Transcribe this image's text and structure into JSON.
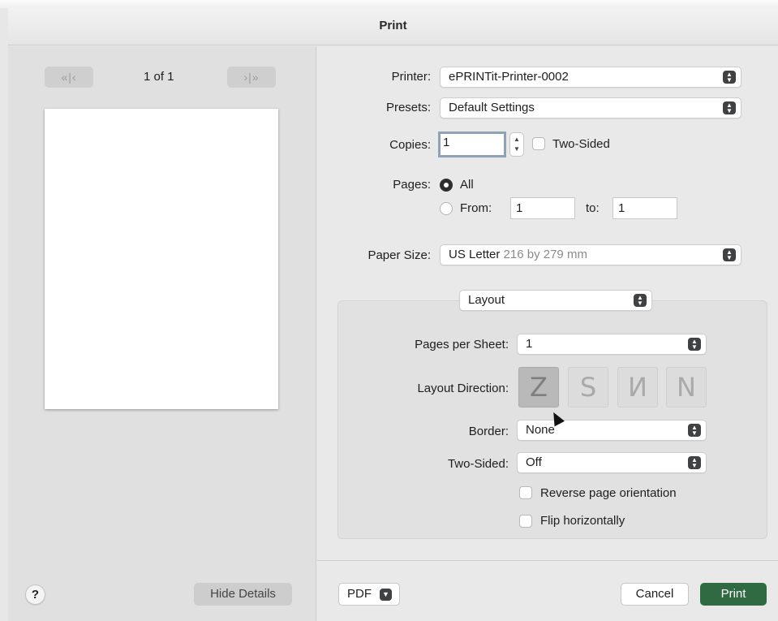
{
  "window": {
    "title": "Print"
  },
  "preview": {
    "prev_label": "«|‹",
    "next_label": "›|»",
    "page_count": "1 of 1",
    "help_label": "?",
    "hide_details_label": "Hide Details"
  },
  "printer": {
    "label": "Printer:",
    "value": "ePRINTit-Printer-0002"
  },
  "presets": {
    "label": "Presets:",
    "value": "Default Settings"
  },
  "copies": {
    "label": "Copies:",
    "value": "1",
    "two_sided_label": "Two-Sided"
  },
  "pages": {
    "label": "Pages:",
    "all_label": "All",
    "from_label": "From:",
    "from_value": "1",
    "to_label": "to:",
    "to_value": "1",
    "selected": "All"
  },
  "paper_size": {
    "label": "Paper Size:",
    "value": "US Letter",
    "detail": "216 by 279 mm"
  },
  "section_popup": {
    "value": "Layout"
  },
  "layout": {
    "pages_per_sheet_label": "Pages per Sheet:",
    "pages_per_sheet_value": "1",
    "direction_label": "Layout Direction:",
    "direction_icons": [
      "layout-z-icon",
      "layout-reverse-z-icon",
      "layout-n-reverse-icon",
      "layout-n-icon"
    ],
    "border_label": "Border:",
    "border_value": "None",
    "two_sided_label": "Two-Sided:",
    "two_sided_value": "Off",
    "reverse_label": "Reverse page orientation",
    "flip_label": "Flip horizontally"
  },
  "footer": {
    "pdf_label": "PDF",
    "cancel_label": "Cancel",
    "print_label": "Print"
  },
  "colors": {
    "accent": "#2f6a43",
    "focus": "#8fa2b6"
  }
}
